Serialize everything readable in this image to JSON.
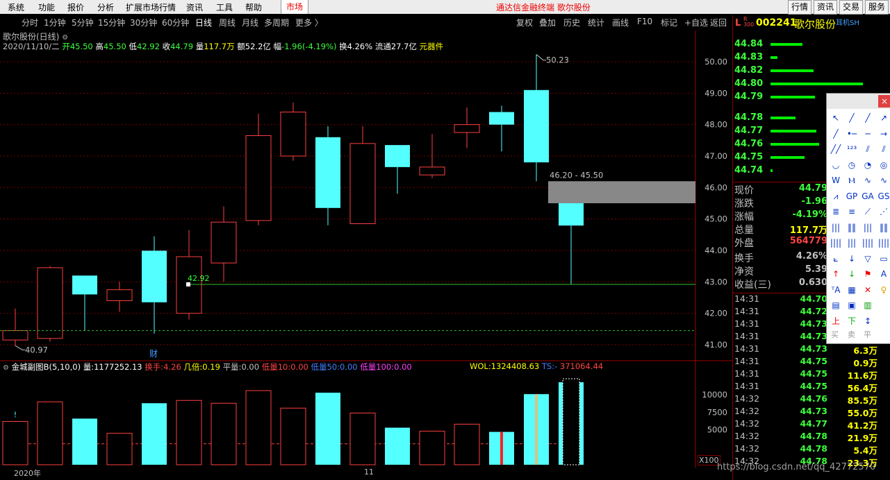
{
  "menu": {
    "items": [
      "系统",
      "功能",
      "报价",
      "分析",
      "扩展市场行情",
      "资讯",
      "工具",
      "帮助"
    ],
    "market": "市场",
    "title": "通达信金融终端  歌尔股份",
    "right_buttons": [
      "行情",
      "资讯",
      "交易",
      "服务"
    ]
  },
  "periods": {
    "items": [
      "分时",
      "1分钟",
      "5分钟",
      "15分钟",
      "30分钟",
      "60分钟",
      "日线",
      "周线",
      "月线",
      "多周期",
      "更多 〉"
    ],
    "active": "日线"
  },
  "toolbar": {
    "items": [
      "复权",
      "叠加",
      "历史",
      "统计",
      "画线",
      "F10",
      "标记",
      "+自选",
      "返回"
    ]
  },
  "chart_header": {
    "name": "歌尔股份(日线)",
    "date": "2020/11/10/二",
    "open_label": "开",
    "open": "45.50",
    "high_label": "高",
    "high": "45.50",
    "low_label": "低",
    "low": "42.92",
    "close_label": "收",
    "close": "44.79",
    "vol_label": "量",
    "vol": "117.7万",
    "amt_label": "额",
    "amt": "52.2亿",
    "chg_label": "幅",
    "chg": "-1.96(-4.19%)",
    "turn_label": "换",
    "turn": "4.26%",
    "float_label": "流通",
    "float": "27.7亿",
    "sector": "元器件"
  },
  "chart_data": {
    "type": "candlestick",
    "ylim": [
      40.6,
      50.6
    ],
    "yticks": [
      "50.00",
      "49.00",
      "48.00",
      "47.00",
      "46.00",
      "45.00",
      "44.00",
      "43.00",
      "42.00",
      "41.00"
    ],
    "candles": [
      {
        "o": 41.15,
        "h": 42.15,
        "l": 40.97,
        "c": 41.45
      },
      {
        "o": 41.2,
        "h": 43.5,
        "l": 41.1,
        "c": 43.45
      },
      {
        "o": 43.2,
        "h": 43.2,
        "l": 41.45,
        "c": 42.6
      },
      {
        "o": 42.4,
        "h": 43.0,
        "l": 42.05,
        "c": 42.75
      },
      {
        "o": 43.99,
        "h": 44.45,
        "l": 41.35,
        "c": 42.35
      },
      {
        "o": 42.0,
        "h": 44.65,
        "l": 41.8,
        "c": 43.8
      },
      {
        "o": 43.6,
        "h": 45.4,
        "l": 43.0,
        "c": 44.9
      },
      {
        "o": 44.95,
        "h": 48.35,
        "l": 44.8,
        "c": 47.65
      },
      {
        "o": 47.0,
        "h": 48.7,
        "l": 46.85,
        "c": 48.4
      },
      {
        "o": 47.6,
        "h": 47.95,
        "l": 44.8,
        "c": 45.35
      },
      {
        "o": 44.85,
        "h": 47.95,
        "l": 44.85,
        "c": 47.4
      },
      {
        "o": 47.35,
        "h": 47.35,
        "l": 45.8,
        "c": 46.65
      },
      {
        "o": 46.4,
        "h": 47.7,
        "l": 46.3,
        "c": 46.65
      },
      {
        "o": 47.75,
        "h": 48.55,
        "l": 47.25,
        "c": 48.0
      },
      {
        "o": 48.4,
        "h": 48.6,
        "l": 47.15,
        "c": 48.0
      },
      {
        "o": 49.1,
        "h": 50.23,
        "l": 46.2,
        "c": 46.8
      },
      {
        "o": 45.5,
        "h": 45.5,
        "l": 42.92,
        "c": 44.79
      }
    ],
    "annotations": {
      "high_label": "50.23",
      "low_label": "40.97",
      "mid_label": "42.92",
      "gap_label": "46.20 - 45.50",
      "finance_mark": "财"
    },
    "gap": {
      "from": 45.5,
      "to": 46.2
    },
    "ref_line": 42.92,
    "low_dash": 41.45
  },
  "volume": {
    "header": {
      "name": "金城副图B(5,10,0)",
      "vol_label": "量:",
      "vol": "1177252.13",
      "turn_label": "换手:",
      "turn": "4.26",
      "ratio_label": "几倍:",
      "ratio": "0.19",
      "flat_label": "平量:",
      "flat": "0.00",
      "l10_label": "低量10:",
      "l10": "0.00",
      "l50_label": "低量50:",
      "l50": "0.00",
      "l100_label": "低量100:",
      "l100": "0.00",
      "wol_label": "WOL:",
      "wol": "1324408.63",
      "ts_label": "TS:",
      "ts": "-",
      "rm": "371064.44"
    },
    "yticks": [
      "10000",
      "7500",
      "5000"
    ],
    "unit": "X100",
    "values": [
      6200,
      9000,
      6600,
      4500,
      8800,
      9200,
      8800,
      10600,
      8100,
      10300,
      7400,
      5300,
      4800,
      5800,
      4700,
      10100,
      11800
    ]
  },
  "x_axis": {
    "labels": [
      "2020年",
      "11"
    ]
  },
  "quote": {
    "code_prefix": "L",
    "code": "002241",
    "name": "歌尔股份",
    "tag": "耳机SH",
    "order_book": [
      {
        "price": "44.84",
        "bar": 0.33
      },
      {
        "price": "44.83",
        "bar": 0.07
      },
      {
        "price": "44.82",
        "bar": 0.44
      },
      {
        "price": "44.80",
        "bar": 0.95
      },
      {
        "price": "44.79",
        "bar": 0.46
      },
      {
        "price": "44.78",
        "bar": 0.26
      },
      {
        "price": "44.77",
        "bar": 0.47
      },
      {
        "price": "44.76",
        "bar": 0.5
      },
      {
        "price": "44.75",
        "bar": 0.35
      },
      {
        "price": "44.74",
        "bar": 0.02
      }
    ],
    "stats": [
      {
        "k": "现价",
        "v": "44.79",
        "color": "#3cff3c"
      },
      {
        "k": "涨跌",
        "v": "-1.96",
        "color": "#3cff3c"
      },
      {
        "k": "涨幅",
        "v": "-4.19%",
        "color": "#3cff3c"
      },
      {
        "k": "总量",
        "v": "117.7万",
        "color": "#ffff00"
      },
      {
        "k": "外盘",
        "v": "564779",
        "color": "#ff4444"
      },
      {
        "k": "换手",
        "v": "4.26%",
        "color": "#c0c0c0"
      },
      {
        "k": "净资",
        "v": "5.39",
        "color": "#c0c0c0"
      },
      {
        "k": "收益(三)",
        "v": "0.630",
        "color": "#c0c0c0"
      }
    ],
    "ticks": [
      {
        "t": "14:31",
        "p": "44.70",
        "q": ""
      },
      {
        "t": "14:31",
        "p": "44.72",
        "q": ""
      },
      {
        "t": "14:31",
        "p": "44.73",
        "q": ""
      },
      {
        "t": "14:31",
        "p": "44.73",
        "q": ""
      },
      {
        "t": "14:31",
        "p": "44.73",
        "q": "6.3万"
      },
      {
        "t": "14:31",
        "p": "44.75",
        "q": "0.9万"
      },
      {
        "t": "14:31",
        "p": "44.75",
        "q": "11.6万"
      },
      {
        "t": "14:31",
        "p": "44.75",
        "q": "56.4万"
      },
      {
        "t": "14:32",
        "p": "44.76",
        "q": "85.5万"
      },
      {
        "t": "14:32",
        "p": "44.73",
        "q": "55.0万"
      },
      {
        "t": "14:32",
        "p": "44.77",
        "q": "41.2万"
      },
      {
        "t": "14:32",
        "p": "44.78",
        "q": "21.9万"
      },
      {
        "t": "14:32",
        "p": "44.78",
        "q": "5.4万"
      },
      {
        "t": "14:32",
        "p": "44.78",
        "q": "23.3万"
      }
    ]
  },
  "toolbox": {
    "close": "×",
    "icons": [
      "cursor-icon",
      "line-icon",
      "ray-icon",
      "arrow-line-icon",
      "segment-icon",
      "dot-line-icon",
      "hline-icon",
      "hline-arrow-icon",
      "channel-icon",
      "num-icon",
      "parallel-icon",
      "parallel2-icon",
      "arc-icon",
      "circle-icon",
      "clock-icon",
      "target-icon",
      "wave-icon",
      "zigzag-icon",
      "abc-icon",
      "wave2-icon",
      "mountain-icon",
      "gp-icon",
      "ga-icon",
      "gs-icon",
      "fib-icon",
      "fib2-icon",
      "fan-icon",
      "fan2-icon",
      "bars-icon",
      "bars2-icon",
      "bars3-icon",
      "bars4-icon",
      "barcode-icon",
      "barcode2-icon",
      "barcode3-icon",
      "barcode4-icon",
      "fan3-icon",
      "down-arrow-icon",
      "triangle-icon",
      "rect-icon",
      "up-red-icon",
      "down-green-icon",
      "flag-icon",
      "text-a-icon",
      "text-icon",
      "eraser-icon",
      "delete-icon",
      "bulb-icon",
      "list-icon",
      "list2-icon",
      "money-icon",
      "",
      "up-mark-icon",
      "down-mark-icon",
      "updown-icon",
      ""
    ],
    "trade": [
      "买",
      "卖",
      "平"
    ]
  },
  "watermark": "https://blog.csdn.net/qq_42772570"
}
